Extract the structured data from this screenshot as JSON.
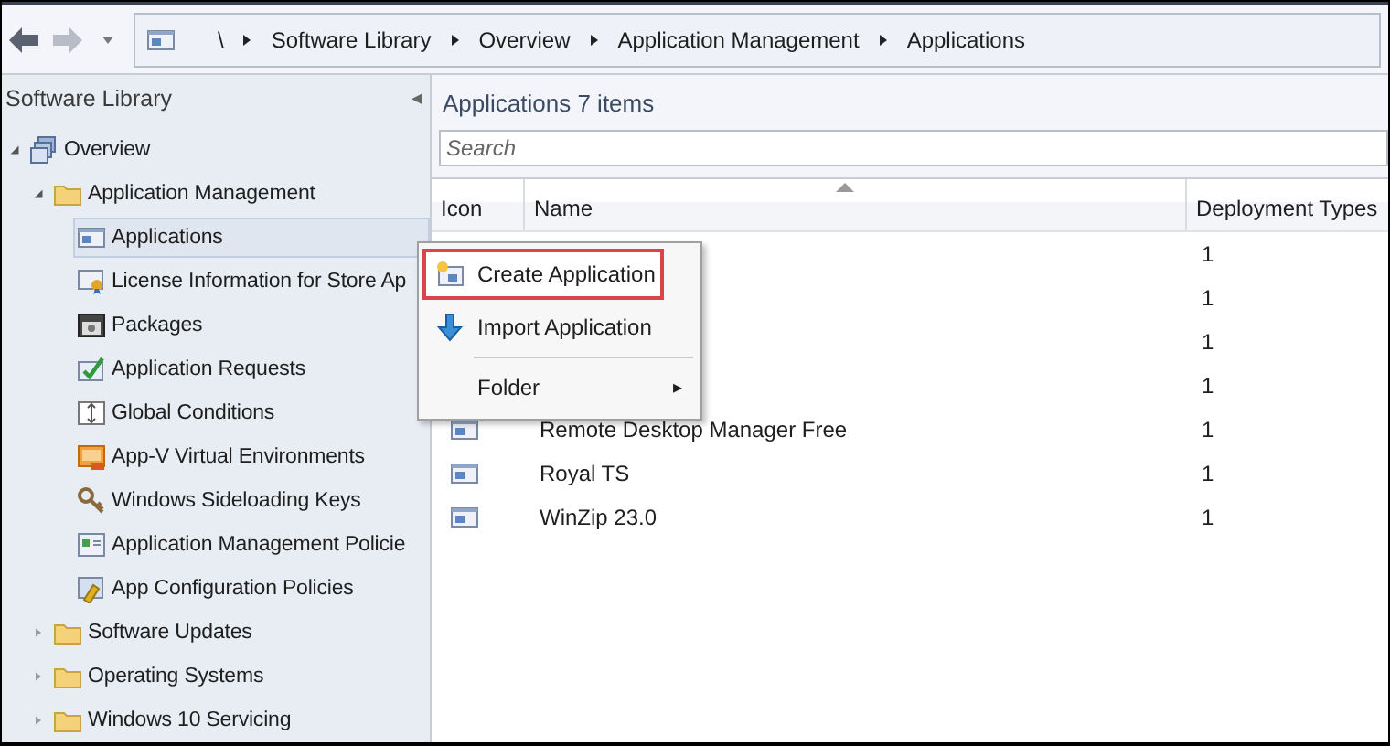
{
  "breadcrumb": [
    "\\",
    "Software Library",
    "Overview",
    "Application Management",
    "Applications"
  ],
  "sidebar": {
    "title": "Software Library",
    "collapse": "◂",
    "items": [
      {
        "label": "Overview",
        "kind": "overview",
        "expanded": true,
        "selected": false,
        "children": [
          {
            "label": "Application Management",
            "kind": "folder",
            "expanded": true,
            "selected": false,
            "children": [
              {
                "label": "Applications",
                "kind": "app",
                "selected": true
              },
              {
                "label": "License Information for Store Ap",
                "kind": "license",
                "selected": false
              },
              {
                "label": "Packages",
                "kind": "package",
                "selected": false
              },
              {
                "label": "Application Requests",
                "kind": "request",
                "selected": false
              },
              {
                "label": "Global Conditions",
                "kind": "condition",
                "selected": false
              },
              {
                "label": "App-V Virtual Environments",
                "kind": "appv",
                "selected": false
              },
              {
                "label": "Windows Sideloading Keys",
                "kind": "key",
                "selected": false
              },
              {
                "label": "Application Management Policie",
                "kind": "policy",
                "selected": false
              },
              {
                "label": "App Configuration Policies",
                "kind": "config",
                "selected": false
              }
            ]
          },
          {
            "label": "Software Updates",
            "kind": "folder",
            "expanded": false,
            "selected": false
          },
          {
            "label": "Operating Systems",
            "kind": "folder",
            "expanded": false,
            "selected": false
          },
          {
            "label": "Windows 10 Servicing",
            "kind": "folder",
            "expanded": false,
            "selected": false
          }
        ]
      }
    ]
  },
  "content": {
    "title": "Applications 7 items",
    "search": {
      "placeholder": "Search"
    },
    "table": {
      "columns": [
        "Icon",
        "Name",
        "Deployment Types"
      ],
      "rows": [
        {
          "deployment_types": "1"
        },
        {
          "deployment_types": "1"
        },
        {
          "deployment_types": "1"
        },
        {
          "deployment_types": "1"
        },
        {
          "name": "Remote Desktop Manager Free",
          "deployment_types": "1"
        },
        {
          "name": "Royal TS",
          "deployment_types": "1"
        },
        {
          "name": "WinZip 23.0",
          "deployment_types": "1"
        }
      ]
    }
  },
  "context_menu": {
    "items": [
      {
        "kind": "item",
        "label": "Create Application",
        "highlighted": true
      },
      {
        "kind": "item",
        "label": "Import Application",
        "highlighted": false
      },
      {
        "kind": "separator"
      },
      {
        "kind": "submenu",
        "label": "Folder",
        "arrow": "▸",
        "highlighted": false
      }
    ]
  }
}
